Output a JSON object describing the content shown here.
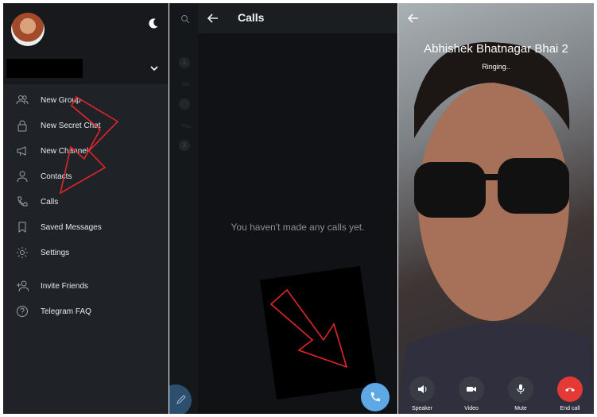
{
  "drawer": {
    "items": [
      {
        "label": "New Group",
        "icon": "group-icon"
      },
      {
        "label": "New Secret Chat",
        "icon": "lock-icon"
      },
      {
        "label": "New Channel",
        "icon": "megaphone-icon"
      },
      {
        "label": "Contacts",
        "icon": "person-icon"
      },
      {
        "label": "Calls",
        "icon": "phone-icon"
      },
      {
        "label": "Saved Messages",
        "icon": "bookmark-icon"
      },
      {
        "label": "Settings",
        "icon": "gear-icon"
      }
    ],
    "items2": [
      {
        "label": "Invite Friends",
        "icon": "add-person-icon"
      },
      {
        "label": "Telegram FAQ",
        "icon": "help-icon"
      }
    ]
  },
  "strip": {
    "badge1": "1",
    "day1": "Sat",
    "day2": "Thu",
    "badge2": "2"
  },
  "calls": {
    "title": "Calls",
    "empty": "You haven't made any calls yet."
  },
  "video_call": {
    "name": "Abhishek Bhatnagar Bhai 2",
    "status": "Ringing..",
    "controls": {
      "speaker": "Speaker",
      "video": "Video",
      "mute": "Mute",
      "end": "End call"
    }
  },
  "colors": {
    "accent": "#5fa8e6",
    "end_call": "#e53935",
    "annotation": "#e0262b"
  }
}
